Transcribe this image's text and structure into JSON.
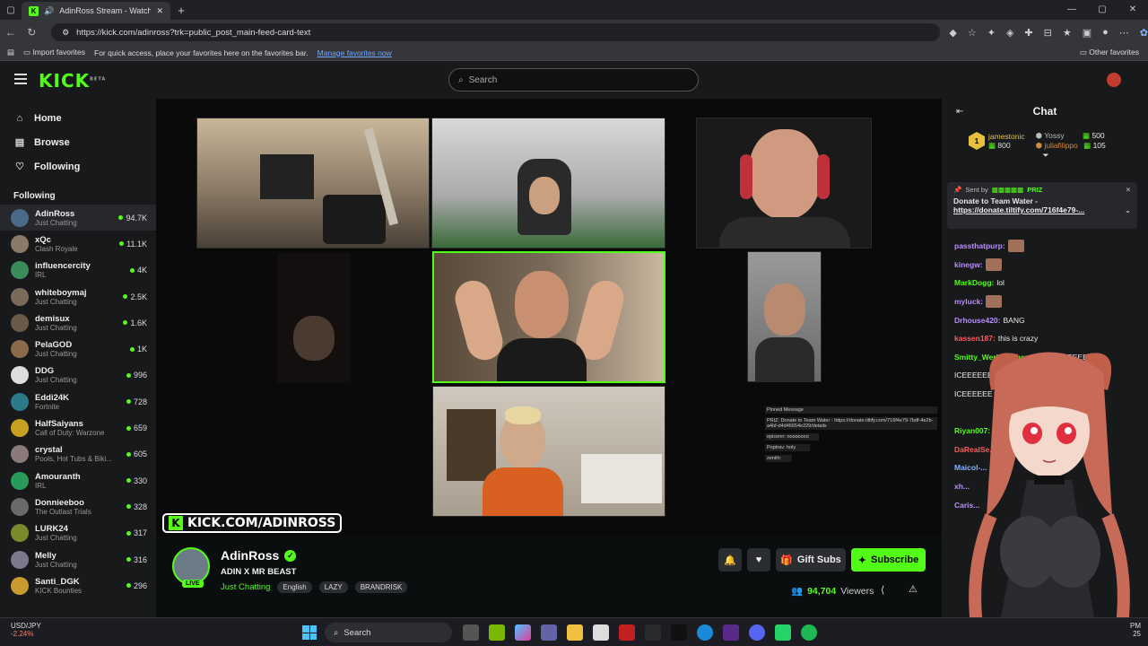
{
  "browser": {
    "tab_title": "AdinRoss Stream - Watch Li...",
    "url": "https://kick.com/adinross?trk=public_post_main-feed-card-text",
    "favbar": {
      "import_label": "Import favorites",
      "hint": "For quick access, place your favorites here on the favorites bar.",
      "manage_link": "Manage favorites now",
      "other_label": "Other favorites"
    }
  },
  "kick": {
    "logo": "KICK",
    "logo_badge": "BETA",
    "search_placeholder": "Search"
  },
  "sidebar": {
    "nav": [
      {
        "label": "Home",
        "icon": "home-icon"
      },
      {
        "label": "Browse",
        "icon": "browse-icon"
      },
      {
        "label": "Following",
        "icon": "heart-icon"
      }
    ],
    "following_heading": "Following",
    "channels": [
      {
        "name": "AdinRoss",
        "category": "Just Chatting",
        "viewers": "94.7K",
        "color": "#4a6a8a"
      },
      {
        "name": "xQc",
        "category": "Clash Royale",
        "viewers": "11.1K",
        "color": "#8a7a6a"
      },
      {
        "name": "influencercity",
        "category": "IRL",
        "viewers": "4K",
        "color": "#3a8a5a"
      },
      {
        "name": "whiteboymaj",
        "category": "Just Chatting",
        "viewers": "2.5K",
        "color": "#7a6a5a"
      },
      {
        "name": "demisux",
        "category": "Just Chatting",
        "viewers": "1.6K",
        "color": "#6a5a4a"
      },
      {
        "name": "PelaGOD",
        "category": "Just Chatting",
        "viewers": "1K",
        "color": "#8a6a4a"
      },
      {
        "name": "DDG",
        "category": "Just Chatting",
        "viewers": "996",
        "color": "#dddddd"
      },
      {
        "name": "Eddi24K",
        "category": "Fortnite",
        "viewers": "728",
        "color": "#2a7a8a"
      },
      {
        "name": "HalfSaiyans",
        "category": "Call of Duty: Warzone",
        "viewers": "659",
        "color": "#c8a020"
      },
      {
        "name": "crystal",
        "category": "Pools, Hot Tubs & Biki...",
        "viewers": "605",
        "color": "#8a7a7a"
      },
      {
        "name": "Amouranth",
        "category": "IRL",
        "viewers": "330",
        "color": "#2a9a5a"
      },
      {
        "name": "Donnieeboo",
        "category": "The Outlast Trials",
        "viewers": "328",
        "color": "#6a6a6a"
      },
      {
        "name": "LURK24",
        "category": "Just Chatting",
        "viewers": "317",
        "color": "#7a8a2a"
      },
      {
        "name": "Melly",
        "category": "Just Chatting",
        "viewers": "316",
        "color": "#7a7a8a"
      },
      {
        "name": "Santi_DGK",
        "category": "KICK Bounties",
        "viewers": "296",
        "color": "#c89a30"
      }
    ]
  },
  "player": {
    "watermark": "KICK.COM/ADINROSS",
    "pinned_overlay": [
      "Pinned Message",
      "PRIZ: Donate to Team Water - https://donate.tiltify.com/716f4e79-7bdf-4e2b-a4bf-d4d46654e229/details",
      "epicenn: nooooooo",
      "Poptrav: holy",
      "zenith:"
    ]
  },
  "stream": {
    "streamer": "AdinRoss",
    "live_badge": "LIVE",
    "title": "ADIN X MR BEAST",
    "category": "Just Chatting",
    "tags": [
      "English",
      "LAZY",
      "BRANDRISK"
    ],
    "gift_label": "Gift Subs",
    "subscribe_label": "Subscribe",
    "viewer_count": "94,704",
    "viewers_label": "Viewers"
  },
  "chat": {
    "title": "Chat",
    "gifters": [
      {
        "rank": "1",
        "name": "jamestonic",
        "count": "800",
        "color": "#e8c040"
      },
      {
        "name": "Yossy",
        "count": "500",
        "color": "#bbbbbb"
      },
      {
        "name": "juliafilippo",
        "count": "105",
        "color": "#d08a40"
      }
    ],
    "pinned": {
      "sent_by_label": "Sent by",
      "sender": "PRIZ",
      "text": "Donate to Team Water -",
      "link": "https://donate.tiltify.com/716f4e79-..."
    },
    "messages": [
      {
        "user": "passthatpurp:",
        "text": "",
        "color": "#b98cff",
        "emote": true
      },
      {
        "user": "kinegw:",
        "text": "",
        "color": "#b98cff",
        "emote": true
      },
      {
        "user": "MarkDogg:",
        "text": "lol",
        "color": "#53fc18",
        "emote": false
      },
      {
        "user": "myluck:",
        "text": "",
        "color": "#b98cff",
        "emote": true
      },
      {
        "user": "Drhouse420:",
        "text": "BANG",
        "color": "#b98cff",
        "emote": false
      },
      {
        "user": "kassen187:",
        "text": "this is crazy",
        "color": "#ff5a5a",
        "emote": false
      },
      {
        "user": "Smitty_Werbenjagermanjen:",
        "text": "ICEEEEEE",
        "color": "#53fc18",
        "emote": false
      },
      {
        "user": "",
        "text": "ICEEEEEE ICEEEEEE",
        "color": "#eeeeee",
        "emote": false
      },
      {
        "user": "",
        "text": "ICEEEEEE",
        "color": "#eeeeee",
        "emote": false
      },
      {
        "user": "",
        "text": "",
        "color": "#e8c040",
        "emote": false
      },
      {
        "user": "Riyan007:",
        "text": "",
        "color": "#53fc18",
        "emote": false
      },
      {
        "user": "DaRealSe...",
        "text": "",
        "color": "#ff5a5a",
        "emote": false
      },
      {
        "user": "Maicol-...",
        "text": "",
        "color": "#8ab4ff",
        "emote": false
      },
      {
        "user": "xh...",
        "text": "",
        "color": "#b98cff",
        "emote": false
      },
      {
        "user": "Caris...",
        "text": "",
        "color": "#b98cff",
        "emote": false
      }
    ]
  },
  "taskbar": {
    "stock_name": "USD/JPY",
    "stock_change": "-2.24%",
    "search_placeholder": "Search",
    "time_fragment": "PM",
    "date_fragment": "25"
  }
}
